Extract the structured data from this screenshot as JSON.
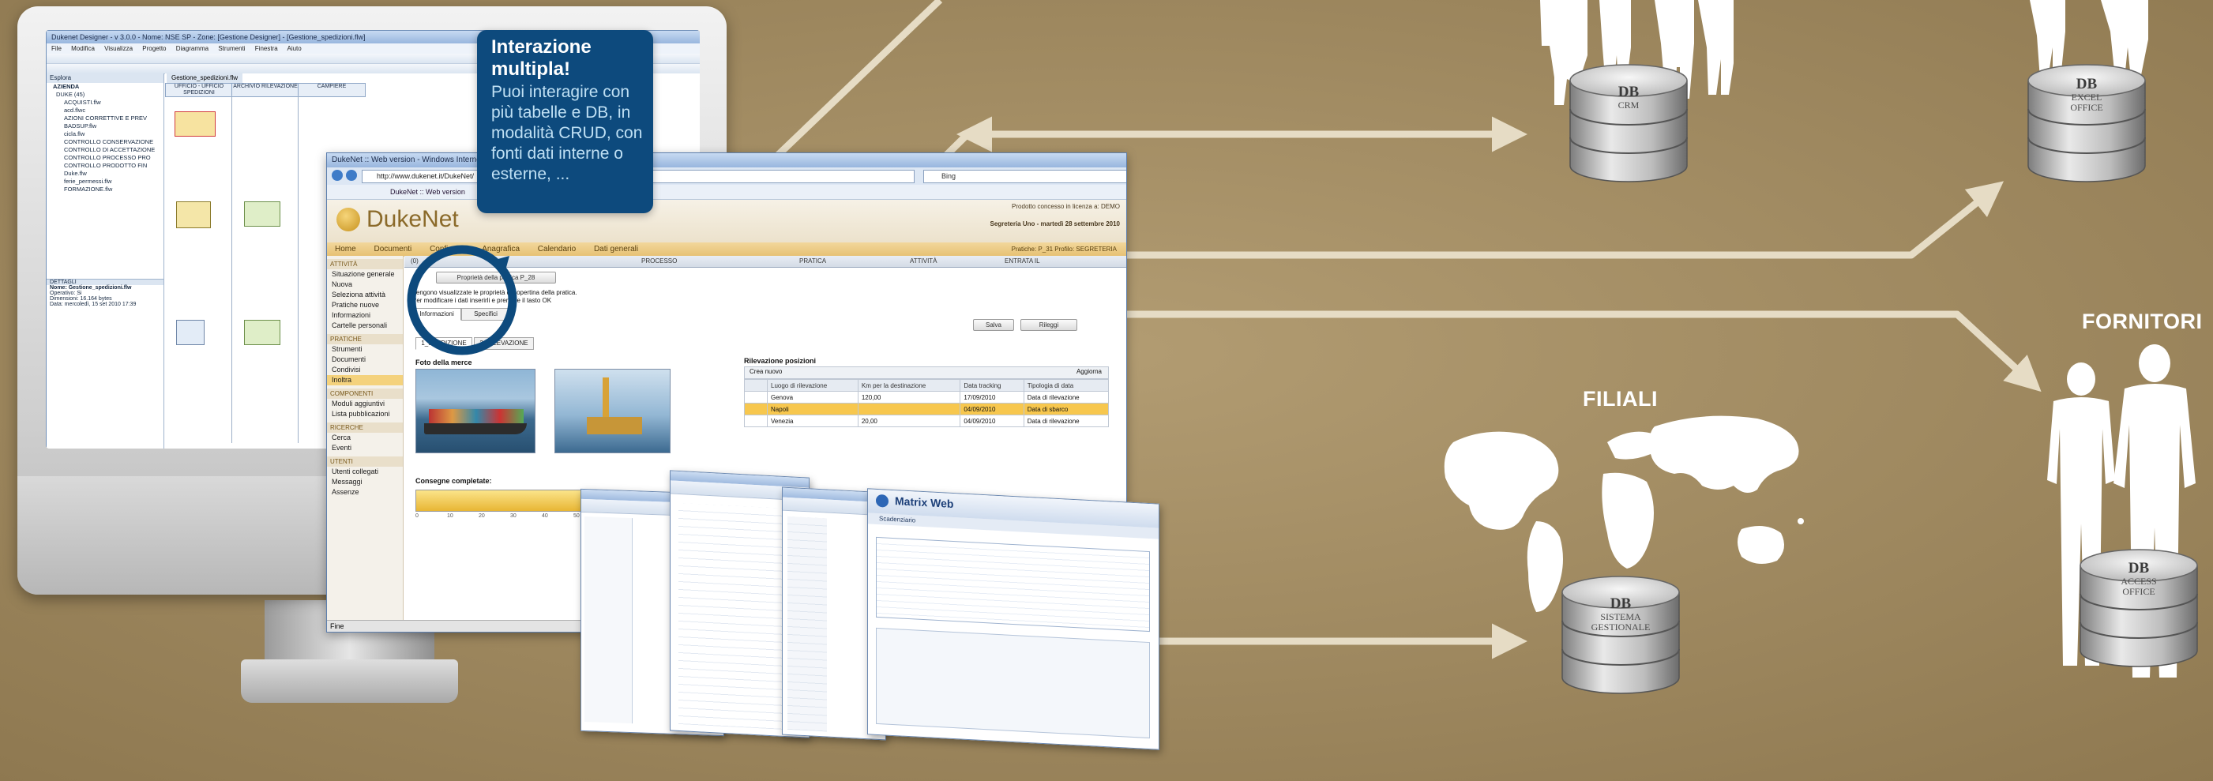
{
  "callout": {
    "title": "Interazione multipla!",
    "body": "Puoi interagire con più tabelle e DB, in modalità CRUD, con fonti dati interne o esterne, ..."
  },
  "groups": {
    "fornitori": "FORNITORI",
    "filiali": "FILIALI"
  },
  "databases": [
    {
      "label": "DB",
      "sub": "CRM"
    },
    {
      "label": "DB",
      "sub": "EXCEL OFFICE"
    },
    {
      "label": "DB",
      "sub": "SISTEMA GESTIONALE"
    },
    {
      "label": "DB",
      "sub": "ACCESS OFFICE"
    }
  ],
  "designer": {
    "title": "Dukenet Designer - v 3.0.0 - Nome: NSE SP - Zone: [Gestione Designer] - [Gestione_spedizioni.flw]",
    "menu": [
      "File",
      "Modifica",
      "Visualizza",
      "Progetto",
      "Diagramma",
      "Strumenti",
      "Finestra",
      "Aiuto"
    ],
    "explorer_title": "Esplora",
    "doc_tab": "Gestione_spedizioni.flw",
    "tree_root": "AZIENDA",
    "tree": [
      "DUKE (45)",
      "ACQUISTI.flw",
      "acd.flwc",
      "AZIONI CORRETTIVE E PREV",
      "BADSUP.flw",
      "cicla.flw",
      "CONTROLLO CONSERVAZIONE",
      "CONTROLLO DI ACCETTAZIONE",
      "CONTROLLO PROCESSO PRO",
      "CONTROLLO PRODOTTO FIN",
      "Duke.flw",
      "ferie_permessi.flw",
      "FORMAZIONE.flw"
    ],
    "columns": [
      "UFFICIO - UFFICIO SPEDIZIONI",
      "ARCHIVIO RILEVAZIONE",
      "CAMPIERE"
    ],
    "details": [
      "Nome: Gestione_spedizioni.flw",
      "Operativo: Si",
      "Dimensioni: 16.164 bytes",
      "Data: mercoledì, 15 set 2010 17:39"
    ],
    "details_title": "DETTAGLI"
  },
  "web": {
    "title": "DukeNet :: Web version - Windows Internet Explorer",
    "url": "http://www.dukenet.it/DukeNet/",
    "search": "Bing",
    "tab": "DukeNet :: Web version",
    "logo": "DukeNet",
    "licensed": "Prodotto concesso in licenza a: DEMO",
    "user_line": "Segreteria Uno - martedì 28 settembre 2010",
    "nav": [
      "Home",
      "Documenti",
      "Configura",
      "Anagrafica",
      "Calendario",
      "Dati generali"
    ],
    "nav_right": "Pratiche: P_31   Profilo: SEGRETERIA",
    "side": {
      "attivita": "ATTIVITÀ",
      "attivita_items": [
        "Situazione generale",
        "Nuova",
        "Seleziona attività",
        "Pratiche nuove",
        "Informazioni",
        "Cartelle personali"
      ],
      "pratiche": "PRATICHE",
      "pratiche_items": [
        "Strumenti",
        "Documenti",
        "Condivisi",
        "Inoltra"
      ],
      "componenti": "COMPONENTI",
      "componenti_items": [
        "Moduli aggiuntivi",
        "Lista pubblicazioni"
      ],
      "ricerche": "RICERCHE",
      "ricerche_items": [
        "Cerca",
        "Eventi"
      ],
      "utenti": "UTENTI",
      "utenti_items": [
        "Utenti collegati",
        "Messaggi",
        "Assenze"
      ]
    },
    "grid_cols": [
      "PROCESSO",
      "PRATICA",
      "ATTIVITÀ",
      "ENTRATA IL"
    ],
    "grid_count": "(0)",
    "props_btn": "Proprietà della pratica P_28",
    "info_line1": "Vengono visualizzate le proprietà di copertina della pratica.",
    "info_line2": "Per modificare i dati inserirli e premere il tasto OK",
    "tabs": [
      "Informazioni",
      "Specifici"
    ],
    "save": "Salva",
    "close": "Rileggi",
    "subtabs": [
      "1_SPEDIZIONE",
      "2_RILEVAZIONE"
    ],
    "photo_title": "Foto della merce",
    "pos_title": "Rilevazione posizioni",
    "new_btn": "Crea nuovo",
    "refresh_btn": "Aggiorna",
    "pos_headers": [
      "Luogo di rilevazione",
      "Km per la destinazione",
      "Data tracking",
      "Tipologia di data"
    ],
    "pos_rows": [
      [
        "Genova",
        "120,00",
        "17/09/2010",
        "Data di rilevazione"
      ],
      [
        "Napoli",
        "",
        "04/09/2010",
        "Data di sbarco"
      ],
      [
        "Venezia",
        "20,00",
        "04/09/2010",
        "Data di rilevazione"
      ]
    ],
    "delivered": "Consegne completate:",
    "scale": [
      "0",
      "10",
      "20",
      "30",
      "40",
      "50"
    ],
    "status": "Fine"
  },
  "matrix": {
    "title": "Matrix Web",
    "subtitle": "Scadenziario"
  },
  "colors": {
    "background": "#a08a62",
    "callout": "#0d4a7d",
    "arrow": "#e6dcc5",
    "silhouette": "#ffffff"
  }
}
